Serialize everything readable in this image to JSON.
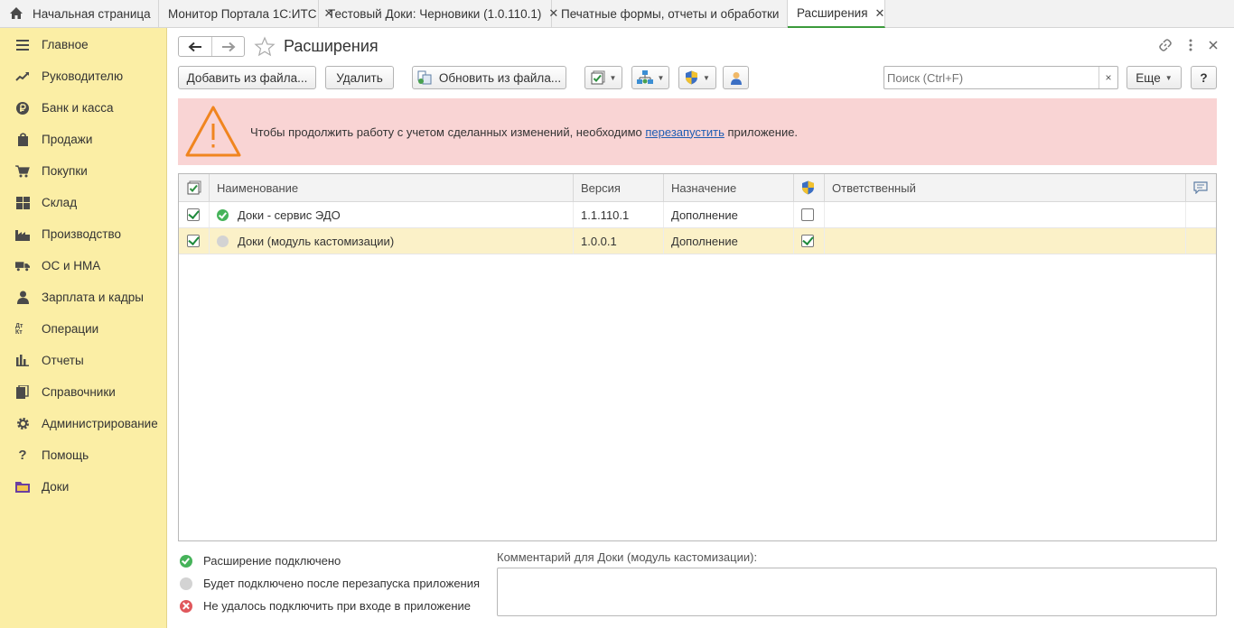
{
  "tabs": [
    {
      "label": "Начальная страница",
      "closable": false,
      "icon": "home-icon"
    },
    {
      "label": "Монитор Портала 1С:ИТС",
      "closable": true
    },
    {
      "label": "Тестовый Доки: Черновики (1.0.110.1)",
      "closable": true
    },
    {
      "label": "Печатные формы, отчеты и обработки",
      "closable": true
    },
    {
      "label": "Расширения",
      "closable": true,
      "active": true
    }
  ],
  "tab_close_glyph": "✕",
  "sidebar": {
    "items": [
      {
        "label": "Главное",
        "icon": "menu-icon"
      },
      {
        "label": "Руководителю",
        "icon": "trend-icon"
      },
      {
        "label": "Банк и касса",
        "icon": "ruble-icon"
      },
      {
        "label": "Продажи",
        "icon": "bag-icon"
      },
      {
        "label": "Покупки",
        "icon": "cart-icon"
      },
      {
        "label": "Склад",
        "icon": "warehouse-icon"
      },
      {
        "label": "Производство",
        "icon": "factory-icon"
      },
      {
        "label": "ОС и НМА",
        "icon": "truck-icon"
      },
      {
        "label": "Зарплата и кадры",
        "icon": "person-icon"
      },
      {
        "label": "Операции",
        "icon": "dt-kt-icon"
      },
      {
        "label": "Отчеты",
        "icon": "bar-chart-icon"
      },
      {
        "label": "Справочники",
        "icon": "books-icon"
      },
      {
        "label": "Администрирование",
        "icon": "gear-icon"
      },
      {
        "label": "Помощь",
        "icon": "question-icon"
      },
      {
        "label": "Доки",
        "icon": "folder-icon"
      }
    ],
    "glyphs": {
      "dt_kt": "Дт Кт",
      "help": "?"
    }
  },
  "header": {
    "title": "Расширения"
  },
  "toolbar": {
    "add_from_file": "Добавить из файла...",
    "delete": "Удалить",
    "update_from_file": "Обновить из файла...",
    "more": "Еще",
    "help": "?",
    "search_placeholder": "Поиск (Ctrl+F)",
    "search_clear": "×"
  },
  "warning": {
    "text_before": "Чтобы продолжить работу с учетом сделанных изменений, необходимо ",
    "link": "перезапустить",
    "text_after": " приложение."
  },
  "table": {
    "columns": [
      "Наименование",
      "Версия",
      "Назначение",
      "Ответственный"
    ],
    "rows": [
      {
        "active": true,
        "status": "connected",
        "name": "Доки - сервис ЭДО",
        "version": "1.1.110.1",
        "purpose": "Дополнение",
        "safe_mode": false,
        "responsible": ""
      },
      {
        "active": true,
        "status": "pending",
        "name": "Доки (модуль кастомизации)",
        "version": "1.0.0.1",
        "purpose": "Дополнение",
        "safe_mode": true,
        "responsible": "",
        "selected": true
      }
    ]
  },
  "legend": {
    "connected": "Расширение подключено",
    "pending": "Будет подключено после перезапуска приложения",
    "failed": "Не удалось подключить при входе в приложение"
  },
  "comment": {
    "label": "Комментарий для Доки (модуль кастомизации):",
    "value": ""
  },
  "colors": {
    "sidebar_bg": "#fbeea5",
    "warning_bg": "#f9d4d4",
    "selected_row": "#fbf1c8",
    "status_green": "#46b35a",
    "status_gray": "#d3d3d3",
    "status_red": "#e0575c",
    "link": "#1f5db3"
  }
}
